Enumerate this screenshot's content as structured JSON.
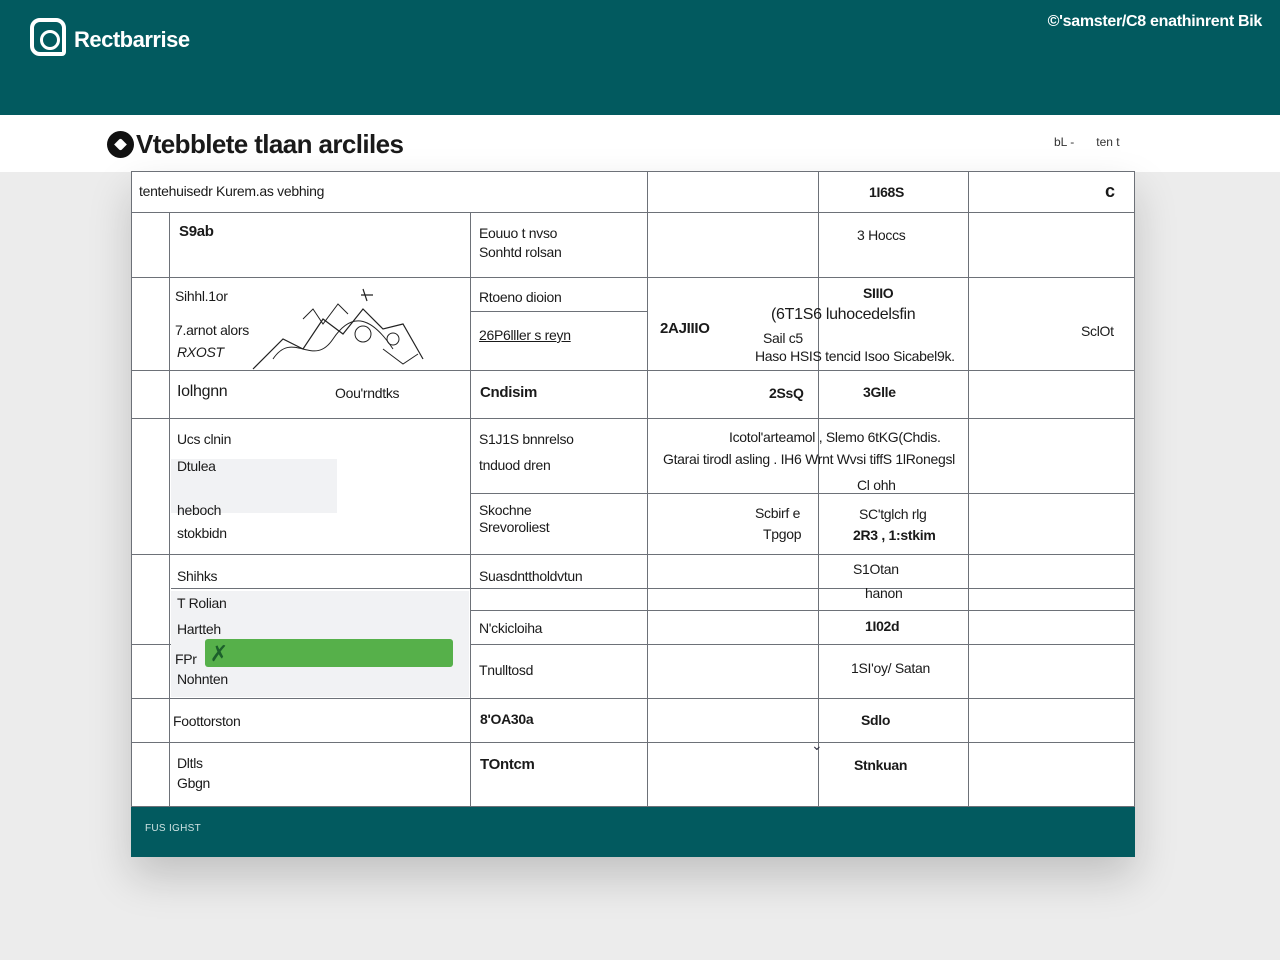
{
  "header": {
    "app_name": "Rectbarrise",
    "right_text": "©'samster/C8 enathinrent Bik"
  },
  "page": {
    "title": "Vtebblete tlaan arcliles",
    "meta": [
      "bL -",
      "ten t"
    ]
  },
  "table": {
    "header_row": {
      "col1": "tentehuisedr Kurem.as vebhing",
      "col4": "1I68S",
      "corner": "c"
    },
    "r1": {
      "a": "S9ab",
      "b1": "Eouuo t nvso",
      "b2": "Sonhtd rolsan",
      "d": "3 Hoccs"
    },
    "r2": {
      "a1": "Sihhl.1or",
      "a2": "7.arnot alors",
      "a3": "RXOST",
      "b1": "Rtoeno dioion",
      "b2": "26P6lller s reyn",
      "c": "2AJIIIO",
      "d0": "SIIIO",
      "d1": "(6T1S6 luhocedelsfin",
      "d2": "Sail c5",
      "d3": "Haso HSIS tencid Isoo Sicabel9k.",
      "e": "SclOt"
    },
    "r3": {
      "a1": "Iolhgnn",
      "a2": "Oou'rndtks",
      "b": "Cndisim",
      "c": "2SsQ",
      "d": "3Glle"
    },
    "r4": {
      "a1": "Ucs clnin",
      "a2": "Dtulea",
      "a3": "heboch",
      "a4": "stokbidn",
      "b1": "S1J1S bnnrelso",
      "b2": "tnduod dren",
      "c1": "Icotol'arteamol ,  Slemo 6tKG(Chdis.",
      "c2": "Gtarai tirodl asling .  IH6 Wrnt Wvsi tiffS 1lRonegsl",
      "d": "Cl ohh"
    },
    "r5": {
      "b1": "Skochne",
      "b2": "Srevoroliest",
      "c1": "Scbirf e",
      "c2": "Tpgop",
      "d1": "SC'tglch rlg",
      "d2": "2R3 , 1:stkim"
    },
    "r6": {
      "a1": "Shihks",
      "a2": "T Rolian",
      "a3": "Hartteh",
      "a4": "FPr",
      "a5": "Nohnten",
      "b1": "Suasdnttholdvtun",
      "b2": "N'ckicloiha",
      "b3": "Tnulltosd",
      "d1": "S1Otan",
      "d2": "hanon",
      "d3": "1I02d",
      "d4": "1SI'oy/  Satan",
      "progress_pct": 100
    },
    "r7": {
      "a": "Foottorston",
      "b": "8'OA30a",
      "d": "Sdlo"
    },
    "r8": {
      "a1": "Dltls",
      "a2": "Gbgn",
      "b": "TOntcm",
      "d": "Stnkuan"
    }
  },
  "footer": {
    "text": "FUS IGHST"
  },
  "colors": {
    "brand": "#025a5f",
    "progress": "#56b04a"
  }
}
